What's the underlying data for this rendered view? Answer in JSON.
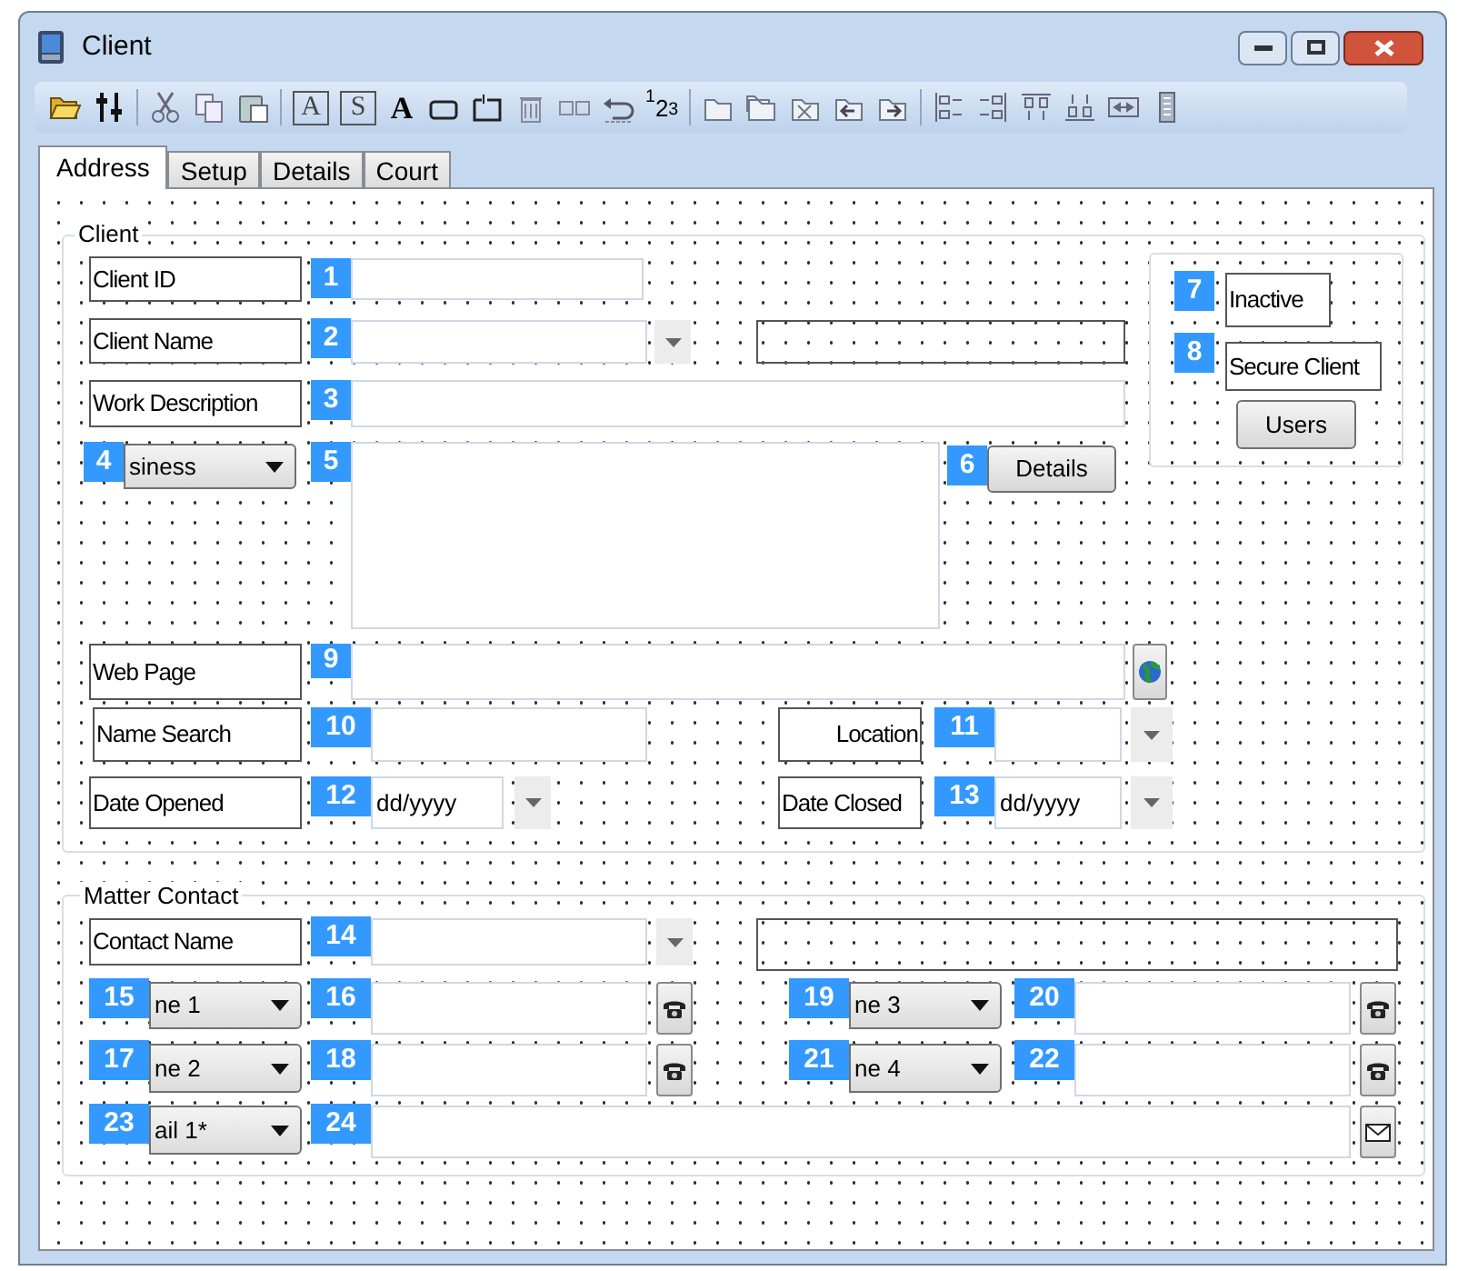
{
  "window": {
    "title": "Client"
  },
  "toolbar_glyphs": [
    "A",
    "S",
    "A",
    "$^{1}$2$_{3}$"
  ],
  "tabs": [
    {
      "label": "Address",
      "selected": true
    },
    {
      "label": "Setup",
      "selected": false
    },
    {
      "label": "Details",
      "selected": false
    },
    {
      "label": "Court",
      "selected": false
    }
  ],
  "client_group": {
    "title": "Client",
    "controls": [
      {
        "kind": "label",
        "text": "Client ID"
      },
      {
        "kind": "textbox",
        "badge": "1"
      },
      {
        "kind": "label",
        "text": "Client Name"
      },
      {
        "kind": "textbox",
        "badge": "2"
      },
      {
        "kind": "arrow"
      },
      {
        "kind": "blank_box"
      },
      {
        "kind": "label",
        "text": "Work Description"
      },
      {
        "kind": "textbox",
        "badge": "3"
      },
      {
        "kind": "dropdown",
        "text": "siness",
        "badge": "4"
      },
      {
        "kind": "textarea",
        "badge": "5"
      },
      {
        "kind": "button",
        "text": "Details",
        "badge": "6"
      },
      {
        "kind": "panel"
      },
      {
        "kind": "label",
        "text": "Inactive",
        "badge": "7"
      },
      {
        "kind": "label",
        "text": "Secure Client",
        "badge": "8"
      },
      {
        "kind": "button",
        "text": "Users"
      },
      {
        "kind": "label",
        "text": "Web Page"
      },
      {
        "kind": "textbox",
        "badge": "9"
      },
      {
        "kind": "icon_button"
      },
      {
        "kind": "label",
        "text": "Name Search"
      },
      {
        "kind": "textbox",
        "badge": "10"
      },
      {
        "kind": "label",
        "text": "Location"
      },
      {
        "kind": "textbox",
        "badge": "11"
      },
      {
        "kind": "arrow"
      },
      {
        "kind": "label",
        "text": "Date Opened"
      },
      {
        "kind": "textbox",
        "text": "dd/yyyy",
        "badge": "12"
      },
      {
        "kind": "arrow"
      },
      {
        "kind": "label",
        "text": "Date Closed"
      },
      {
        "kind": "textbox",
        "text": "dd/yyyy",
        "badge": "13"
      },
      {
        "kind": "arrow"
      }
    ]
  },
  "matter_group": {
    "title": "Matter Contact",
    "controls": [
      {
        "kind": "label",
        "text": "Contact Name"
      },
      {
        "kind": "textbox",
        "badge": "14"
      },
      {
        "kind": "arrow"
      },
      {
        "kind": "blank_box"
      },
      {
        "kind": "dropdown",
        "text": "ne 1",
        "badge": "15"
      },
      {
        "kind": "textbox",
        "badge": "16"
      },
      {
        "kind": "icon_button"
      },
      {
        "kind": "dropdown",
        "text": "ne 3",
        "badge": "19"
      },
      {
        "kind": "textbox",
        "badge": "20"
      },
      {
        "kind": "icon_button"
      },
      {
        "kind": "dropdown",
        "text": "ne 2",
        "badge": "17"
      },
      {
        "kind": "textbox",
        "badge": "18"
      },
      {
        "kind": "icon_button"
      },
      {
        "kind": "dropdown",
        "text": "ne 4",
        "badge": "21"
      },
      {
        "kind": "textbox",
        "badge": "22"
      },
      {
        "kind": "icon_button"
      },
      {
        "kind": "dropdown",
        "text": "ail 1*",
        "badge": "23"
      },
      {
        "kind": "textbox",
        "badge": "24"
      },
      {
        "kind": "icon_button"
      }
    ]
  }
}
